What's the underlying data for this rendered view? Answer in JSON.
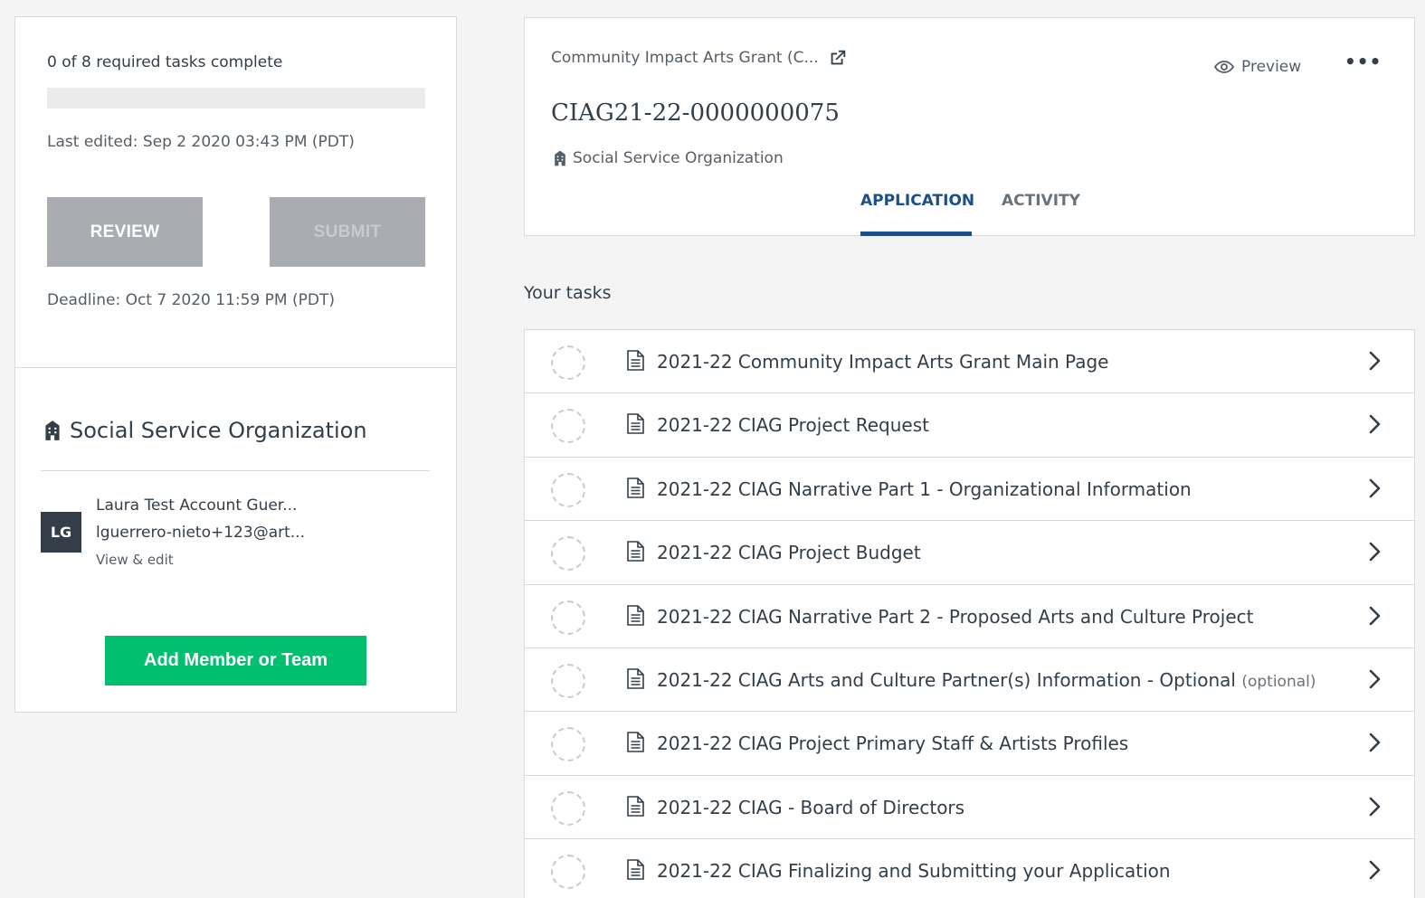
{
  "progress": {
    "text": "0 of 8 required tasks complete",
    "completed": 0,
    "total": 8
  },
  "last_edited": "Last edited: Sep 2 2020 03:43 PM (PDT)",
  "buttons": {
    "review": "REVIEW",
    "submit": "SUBMIT",
    "add_member": "Add Member or Team"
  },
  "deadline": "Deadline: Oct 7 2020 11:59 PM (PDT)",
  "organization": {
    "name": "Social Service Organization",
    "member_initials": "LG",
    "member_name": "Laura Test Account Guer...",
    "member_email": "lguerrero-nieto+123@art...",
    "member_link": "View & edit"
  },
  "header": {
    "grant_name": "Community Impact Arts Grant (C...",
    "preview": "Preview",
    "more": "•••",
    "application_id": "CIAG21-22-0000000075",
    "org": "Social Service Organization",
    "tabs": [
      "APPLICATION",
      "ACTIVITY"
    ]
  },
  "tasks_title": "Your tasks",
  "tasks": [
    {
      "label": "2021-22 Community Impact Arts Grant Main Page",
      "optional": ""
    },
    {
      "label": "2021-22 CIAG Project Request",
      "optional": ""
    },
    {
      "label": "2021-22 CIAG Narrative Part 1 - Organizational Information",
      "optional": ""
    },
    {
      "label": "2021-22 CIAG Project Budget",
      "optional": ""
    },
    {
      "label": "2021-22 CIAG Narrative Part 2 - Proposed Arts and Culture Project",
      "optional": ""
    },
    {
      "label": "2021-22 CIAG Arts and Culture Partner(s) Information - Optional",
      "optional": "(optional)"
    },
    {
      "label": "2021-22 CIAG Project Primary Staff & Artists Profiles",
      "optional": ""
    },
    {
      "label": "2021-22 CIAG - Board of Directors",
      "optional": ""
    },
    {
      "label": "2021-22 CIAG Finalizing and Submitting your Application",
      "optional": ""
    }
  ],
  "colors": {
    "accent_green": "#00bf6f",
    "tab_blue": "#1b4f8a",
    "button_grey": "#a9adb1"
  }
}
